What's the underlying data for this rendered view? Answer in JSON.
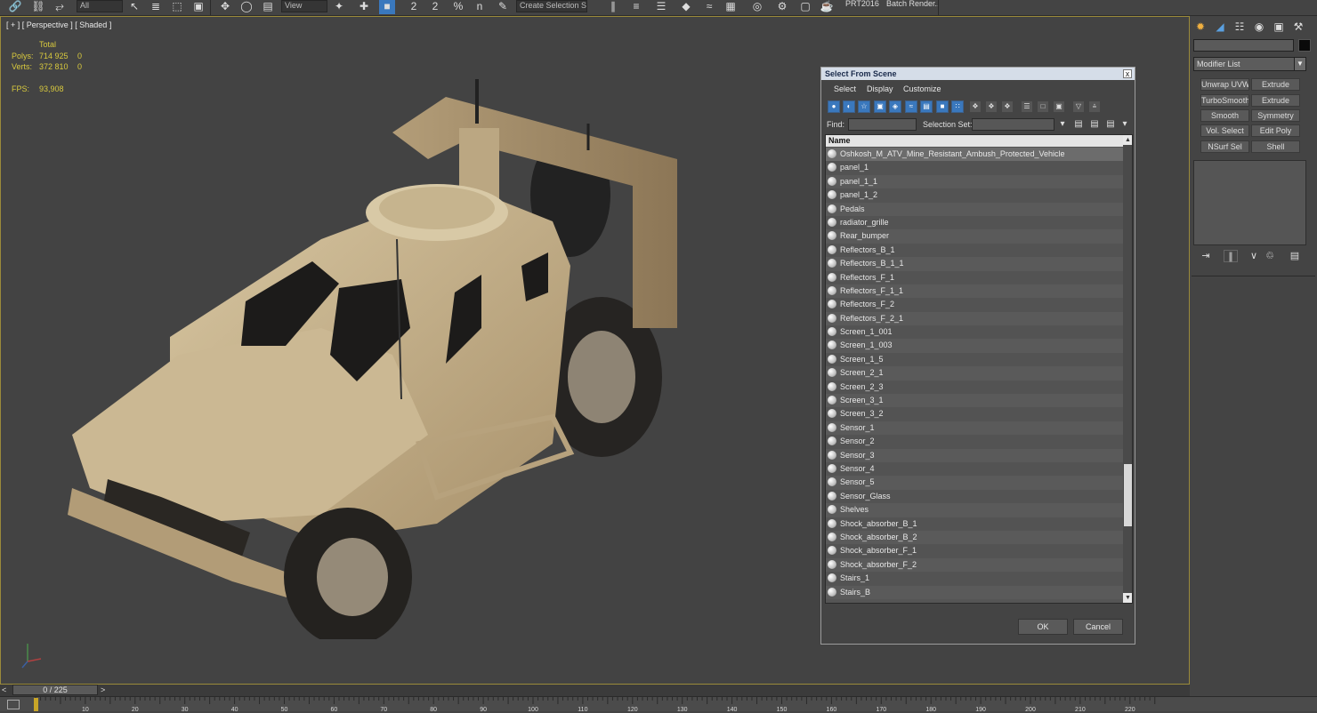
{
  "toolbar": {
    "filter_combo": "All",
    "view_combo": "View",
    "selection_set_combo": "Create Selection Se",
    "project_label": "PRT2016",
    "batch_render_label": "Batch Render..",
    "snap_labels": [
      "2",
      "2",
      "%",
      "n"
    ]
  },
  "viewport": {
    "label": "[ + ] [ Perspective ] [ Shaded ]",
    "stats_total_label": "Total",
    "polys_label": "Polys:",
    "polys_value": "714 925",
    "polys_sel": "0",
    "verts_label": "Verts:",
    "verts_value": "372 810",
    "verts_sel": "0",
    "fps_label": "FPS:",
    "fps_value": "93,908",
    "background_color": "#434343",
    "vehicle_color": "#c4b08a"
  },
  "command_panel": {
    "modifier_list_label": "Modifier List",
    "modifiers": [
      [
        "Unwrap UVW",
        "Extrude"
      ],
      [
        "TurboSmooth",
        "Extrude"
      ],
      [
        "Smooth",
        "Symmetry"
      ],
      [
        "Vol. Select",
        "Edit Poly"
      ],
      [
        "NSurf Sel",
        "Shell"
      ]
    ]
  },
  "dialog": {
    "title": "Select From Scene",
    "close_label": "x",
    "menus": [
      "Select",
      "Display",
      "Customize"
    ],
    "find_label": "Find:",
    "find_value": "",
    "selection_set_label": "Selection Set:",
    "selection_set_value": "",
    "column_header": "Name",
    "items": [
      "Oshkosh_M_ATV_Mine_Resistant_Ambush_Protected_Vehicle",
      "panel_1",
      "panel_1_1",
      "panel_1_2",
      "Pedals",
      "radiator_grille",
      "Rear_bumper",
      "Reflectors_B_1",
      "Reflectors_B_1_1",
      "Reflectors_F_1",
      "Reflectors_F_1_1",
      "Reflectors_F_2",
      "Reflectors_F_2_1",
      "Screen_1_001",
      "Screen_1_003",
      "Screen_1_5",
      "Screen_2_1",
      "Screen_2_3",
      "Screen_3_1",
      "Screen_3_2",
      "Sensor_1",
      "Sensor_2",
      "Sensor_3",
      "Sensor_4",
      "Sensor_5",
      "Sensor_Glass",
      "Shelves",
      "Shock_absorber_B_1",
      "Shock_absorber_B_2",
      "Shock_absorber_F_1",
      "Shock_absorber_F_2",
      "Stairs_1",
      "Stairs_B"
    ],
    "ok_label": "OK",
    "cancel_label": "Cancel"
  },
  "timeline": {
    "frame_label": "0 / 225",
    "prev_label": "<",
    "next_label": ">",
    "ticks": [
      "10",
      "20",
      "30",
      "40",
      "50",
      "60",
      "70",
      "80",
      "90",
      "100",
      "110",
      "120",
      "130",
      "140",
      "150",
      "160",
      "170",
      "180",
      "190",
      "200",
      "210",
      "220"
    ]
  }
}
